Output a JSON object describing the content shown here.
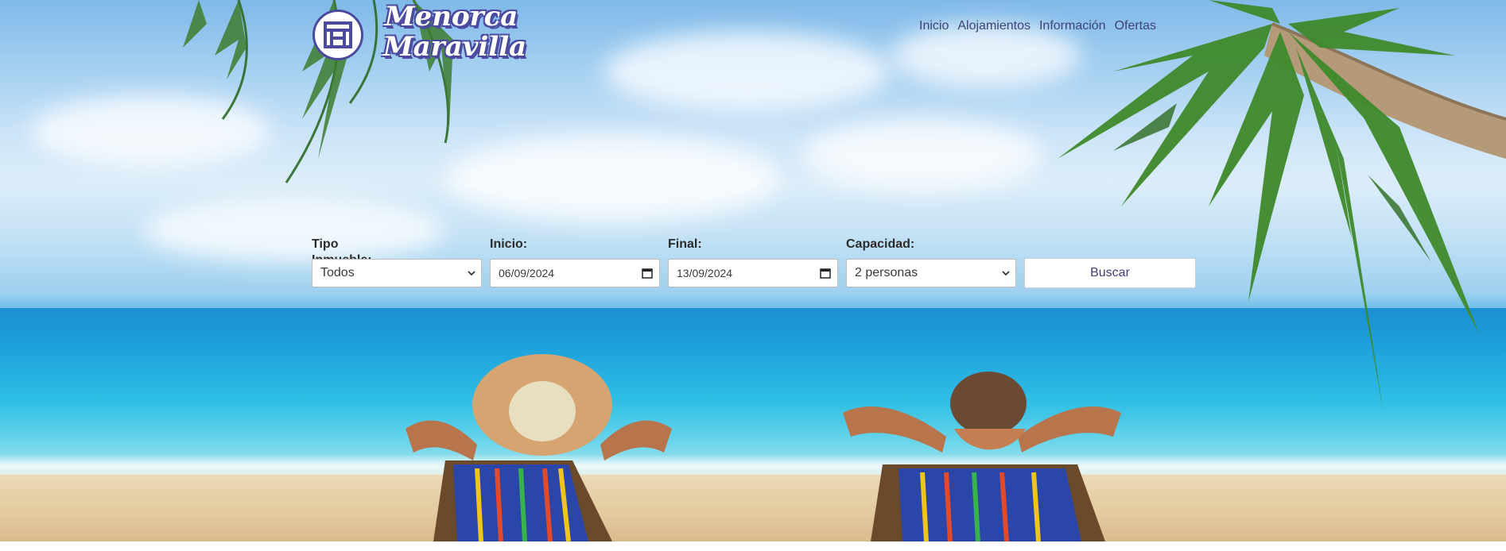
{
  "brand": {
    "line1": "Menorca",
    "line2": "Maravilla",
    "logo_icon": "building-logo-icon"
  },
  "nav": {
    "items": [
      "Inicio",
      "Alojamientos",
      "Información",
      "Ofertas"
    ]
  },
  "search": {
    "tipo_label": "Tipo Inmueble:",
    "tipo_value": "Todos",
    "inicio_label": "Inicio:",
    "inicio_value": "06/09/2024",
    "final_label": "Final:",
    "final_value": "13/09/2024",
    "capacidad_label": "Capacidad:",
    "capacidad_value": "2 personas",
    "button_label": "Buscar"
  },
  "colors": {
    "brand_accent": "#4b4a9e",
    "nav_text": "#3f4277"
  }
}
